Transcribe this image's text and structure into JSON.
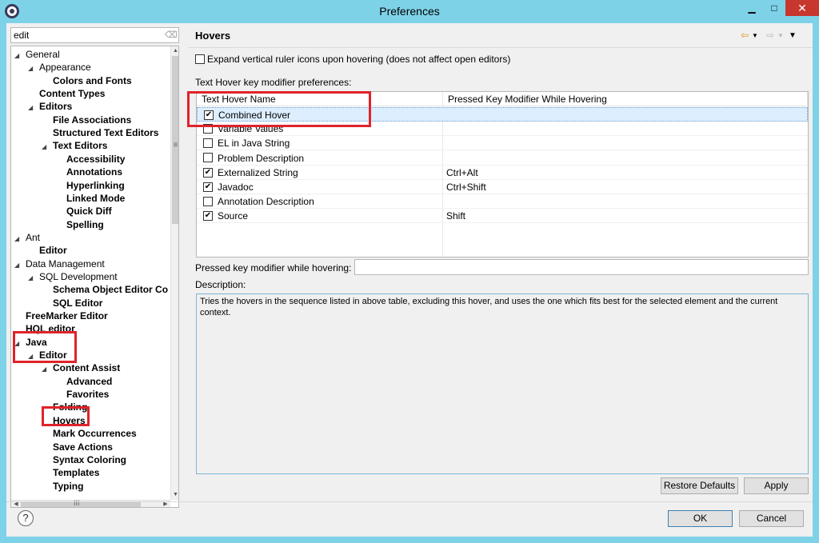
{
  "window": {
    "title": "Preferences"
  },
  "filter": {
    "value": "edit"
  },
  "tree": [
    {
      "label": "General",
      "twist": "◢",
      "indent": 0,
      "bold": false
    },
    {
      "label": "Appearance",
      "twist": "◢",
      "indent": 1,
      "bold": false
    },
    {
      "label": "Colors and Fonts",
      "twist": "",
      "indent": 2,
      "bold": true
    },
    {
      "label": "Content Types",
      "twist": "",
      "indent": 1,
      "bold": true
    },
    {
      "label": "Editors",
      "twist": "◢",
      "indent": 1,
      "bold": true
    },
    {
      "label": "File Associations",
      "twist": "",
      "indent": 2,
      "bold": true
    },
    {
      "label": "Structured Text Editors",
      "twist": "",
      "indent": 2,
      "bold": true
    },
    {
      "label": "Text Editors",
      "twist": "◢",
      "indent": 2,
      "bold": true
    },
    {
      "label": "Accessibility",
      "twist": "",
      "indent": 3,
      "bold": true
    },
    {
      "label": "Annotations",
      "twist": "",
      "indent": 3,
      "bold": true
    },
    {
      "label": "Hyperlinking",
      "twist": "",
      "indent": 3,
      "bold": true
    },
    {
      "label": "Linked Mode",
      "twist": "",
      "indent": 3,
      "bold": true
    },
    {
      "label": "Quick Diff",
      "twist": "",
      "indent": 3,
      "bold": true
    },
    {
      "label": "Spelling",
      "twist": "",
      "indent": 3,
      "bold": true
    },
    {
      "label": "Ant",
      "twist": "◢",
      "indent": 0,
      "bold": false
    },
    {
      "label": "Editor",
      "twist": "",
      "indent": 1,
      "bold": true
    },
    {
      "label": "Data Management",
      "twist": "◢",
      "indent": 0,
      "bold": false
    },
    {
      "label": "SQL Development",
      "twist": "◢",
      "indent": 1,
      "bold": false
    },
    {
      "label": "Schema Object Editor Co",
      "twist": "",
      "indent": 2,
      "bold": true
    },
    {
      "label": "SQL Editor",
      "twist": "",
      "indent": 2,
      "bold": true
    },
    {
      "label": "FreeMarker Editor",
      "twist": "",
      "indent": 0,
      "bold": true
    },
    {
      "label": "HQL editor",
      "twist": "",
      "indent": 0,
      "bold": true
    },
    {
      "label": "Java",
      "twist": "◢",
      "indent": 0,
      "bold": true
    },
    {
      "label": "Editor",
      "twist": "◢",
      "indent": 1,
      "bold": true
    },
    {
      "label": "Content Assist",
      "twist": "◢",
      "indent": 2,
      "bold": true
    },
    {
      "label": "Advanced",
      "twist": "",
      "indent": 3,
      "bold": true
    },
    {
      "label": "Favorites",
      "twist": "",
      "indent": 3,
      "bold": true
    },
    {
      "label": "Folding",
      "twist": "",
      "indent": 2,
      "bold": true
    },
    {
      "label": "Hovers",
      "twist": "",
      "indent": 2,
      "bold": true
    },
    {
      "label": "Mark Occurrences",
      "twist": "",
      "indent": 2,
      "bold": true
    },
    {
      "label": "Save Actions",
      "twist": "",
      "indent": 2,
      "bold": true
    },
    {
      "label": "Syntax Coloring",
      "twist": "",
      "indent": 2,
      "bold": true
    },
    {
      "label": "Templates",
      "twist": "",
      "indent": 2,
      "bold": true
    },
    {
      "label": "Typing",
      "twist": "",
      "indent": 2,
      "bold": true
    }
  ],
  "page": {
    "title": "Hovers",
    "expand_label": "Expand vertical ruler icons upon hovering (does not affect open editors)",
    "expand_checked": false,
    "section_label": "Text Hover key modifier preferences:",
    "col1": "Text Hover Name",
    "col2": "Pressed Key Modifier While Hovering",
    "rows": [
      {
        "name": "Combined Hover",
        "checked": true,
        "modifier": "",
        "selected": true
      },
      {
        "name": "Variable Values",
        "checked": false,
        "modifier": "",
        "selected": false
      },
      {
        "name": "EL in Java String",
        "checked": false,
        "modifier": "",
        "selected": false
      },
      {
        "name": "Problem Description",
        "checked": false,
        "modifier": "",
        "selected": false
      },
      {
        "name": "Externalized String",
        "checked": true,
        "modifier": "Ctrl+Alt",
        "selected": false
      },
      {
        "name": "Javadoc",
        "checked": true,
        "modifier": "Ctrl+Shift",
        "selected": false
      },
      {
        "name": "Annotation Description",
        "checked": false,
        "modifier": "",
        "selected": false
      },
      {
        "name": "Source",
        "checked": true,
        "modifier": "Shift",
        "selected": false
      }
    ],
    "modifier_label": "Pressed key modifier while hovering:",
    "modifier_value": "",
    "description_label": "Description:",
    "description": "Tries the hovers in the sequence listed in above table, excluding this hover, and uses the one which fits best for the selected element and the current context.",
    "restore_label": "Restore Defaults",
    "apply_label": "Apply"
  },
  "footer": {
    "ok_label": "OK",
    "cancel_label": "Cancel",
    "help_glyph": "?"
  },
  "colors": {
    "titlebar": "#7ed2e8",
    "highlight": "#e0232a",
    "close": "#c7372e"
  }
}
